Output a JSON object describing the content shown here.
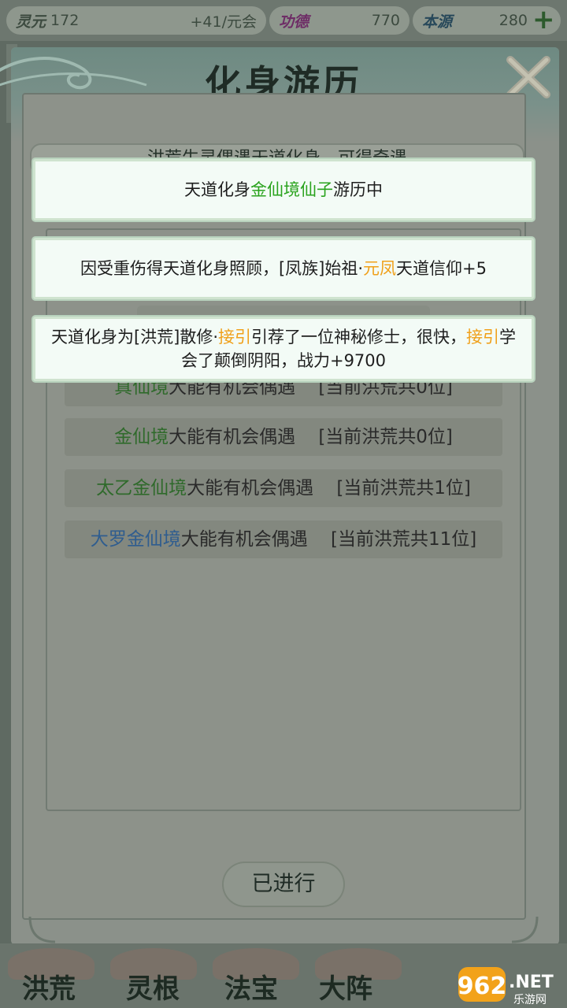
{
  "resources": {
    "lingyuan": {
      "label": "灵元",
      "value": "172",
      "rate": "+41/元会"
    },
    "gongde": {
      "label": "功德",
      "value": "770"
    },
    "benyuan": {
      "label": "本源",
      "value": "280"
    }
  },
  "panel": {
    "title": "化身游历",
    "subtitle": "洪荒生灵偶遇天道化身，可得奇遇",
    "rows": [
      {
        "realm": "真仙境",
        "text": "大能有机会偶遇",
        "count": "[当前洪荒共0位]"
      },
      {
        "realm": "金仙境",
        "text": "大能有机会偶遇",
        "count": "[当前洪荒共0位]"
      },
      {
        "realm": "太乙金仙境",
        "text": "大能有机会偶遇",
        "count": "[当前洪荒共1位]"
      },
      {
        "realm": "大罗金仙境",
        "text": "大能有机会偶遇",
        "count": "[当前洪荒共11位]"
      }
    ],
    "done_button": "已进行"
  },
  "toasts": [
    {
      "parts": [
        "天道化身",
        "金仙境仙子",
        "游历中"
      ]
    },
    {
      "parts": [
        "因受重伤得天道化身照顾，[凤族]始祖·",
        "元凤",
        "天道信仰+5"
      ]
    },
    {
      "parts": [
        "天道化身为[洪荒]散修·",
        "接引",
        "引荐了一位神秘修士，很快，",
        "接引",
        "学会了颠倒阴阳，战力+9700"
      ]
    }
  ],
  "nav": [
    "洪荒",
    "灵根",
    "法宝",
    "大阵"
  ],
  "watermark": {
    "brand": "962",
    "suffix": ".NET",
    "sub": "乐游网"
  },
  "colors": {
    "green": "#2aa31e",
    "orange": "#f0a01a",
    "realm_green": "#2f6a2b",
    "realm_blue": "#2f5d8f"
  }
}
